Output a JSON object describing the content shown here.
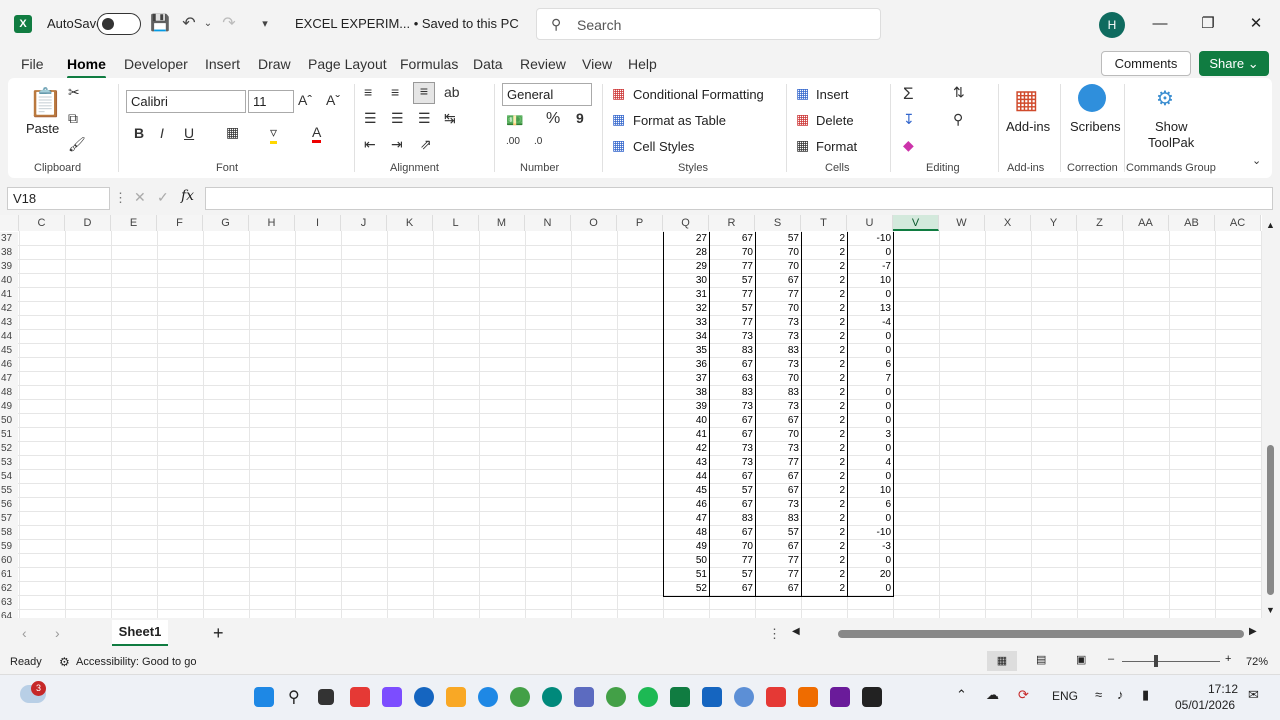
{
  "titlebar": {
    "autosave_label": "AutoSave",
    "doc_title": "EXCEL EXPERIM... • Saved to this PC",
    "search_placeholder": "Search",
    "avatar_initial": "H"
  },
  "tabs": [
    "File",
    "Home",
    "Developer",
    "Insert",
    "Draw",
    "Page Layout",
    "Formulas",
    "Data",
    "Review",
    "View",
    "Help"
  ],
  "active_tab": "Home",
  "actions": {
    "comments": "Comments",
    "share": "Share"
  },
  "ribbon": {
    "clipboard": {
      "paste": "Paste",
      "label": "Clipboard"
    },
    "font": {
      "name": "Calibri",
      "size": "11",
      "label": "Font"
    },
    "alignment": {
      "label": "Alignment"
    },
    "number": {
      "format": "General",
      "label": "Number"
    },
    "styles": {
      "conditional": "Conditional Formatting",
      "format_table": "Format as Table",
      "cell_styles": "Cell Styles",
      "label": "Styles"
    },
    "cells": {
      "insert": "Insert",
      "delete": "Delete",
      "format": "Format",
      "label": "Cells"
    },
    "editing": {
      "label": "Editing"
    },
    "addins": {
      "btn": "Add-ins",
      "label": "Add-ins"
    },
    "correction": {
      "btn": "Scribens",
      "label": "Correction"
    },
    "commands": {
      "btn1": "Show",
      "btn2": "ToolPak",
      "label": "Commands Group"
    }
  },
  "formula_bar": {
    "name_box": "V18",
    "formula": "",
    "fx": "fx"
  },
  "columns": [
    "C",
    "D",
    "E",
    "F",
    "G",
    "H",
    "I",
    "J",
    "K",
    "L",
    "M",
    "N",
    "O",
    "P",
    "Q",
    "R",
    "S",
    "T",
    "U",
    "V",
    "W",
    "X",
    "Y",
    "Z",
    "AA",
    "AB",
    "AC"
  ],
  "selected_column": "V",
  "row_numbers": [
    37,
    38,
    39,
    40,
    41,
    42,
    43,
    44,
    45,
    46,
    47,
    48,
    49,
    50,
    51,
    52,
    53,
    54,
    55,
    56,
    57,
    58,
    59,
    60,
    61,
    62,
    63,
    64
  ],
  "table_rows": [
    [
      27,
      67,
      57,
      2,
      -10
    ],
    [
      28,
      70,
      70,
      2,
      0
    ],
    [
      29,
      77,
      70,
      2,
      -7
    ],
    [
      30,
      57,
      67,
      2,
      10
    ],
    [
      31,
      77,
      77,
      2,
      0
    ],
    [
      32,
      57,
      70,
      2,
      13
    ],
    [
      33,
      77,
      73,
      2,
      -4
    ],
    [
      34,
      73,
      73,
      2,
      0
    ],
    [
      35,
      83,
      83,
      2,
      0
    ],
    [
      36,
      67,
      73,
      2,
      6
    ],
    [
      37,
      63,
      70,
      2,
      7
    ],
    [
      38,
      83,
      83,
      2,
      0
    ],
    [
      39,
      73,
      73,
      2,
      0
    ],
    [
      40,
      67,
      67,
      2,
      0
    ],
    [
      41,
      67,
      70,
      2,
      3
    ],
    [
      42,
      73,
      73,
      2,
      0
    ],
    [
      43,
      73,
      77,
      2,
      4
    ],
    [
      44,
      67,
      67,
      2,
      0
    ],
    [
      45,
      57,
      67,
      2,
      10
    ],
    [
      46,
      67,
      73,
      2,
      6
    ],
    [
      47,
      83,
      83,
      2,
      0
    ],
    [
      48,
      67,
      57,
      2,
      -10
    ],
    [
      49,
      70,
      67,
      2,
      -3
    ],
    [
      50,
      77,
      77,
      2,
      0
    ],
    [
      51,
      57,
      77,
      2,
      20
    ],
    [
      52,
      67,
      67,
      2,
      0
    ]
  ],
  "sheet": {
    "name": "Sheet1"
  },
  "status": {
    "ready": "Ready",
    "accessibility": "Accessibility: Good to go",
    "zoom": "72%"
  },
  "taskbar": {
    "lang": "ENG",
    "time": "17:12",
    "date": "05/01/2026",
    "weather_badge": "3"
  }
}
